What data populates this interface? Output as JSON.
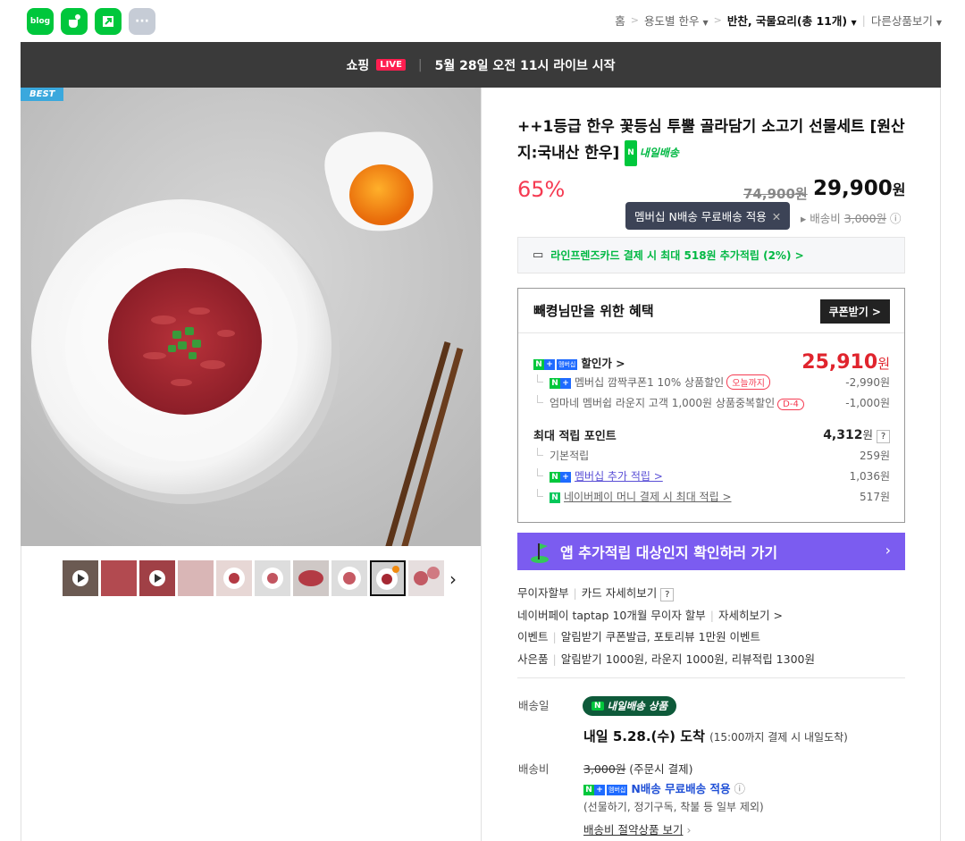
{
  "top_icons": [
    {
      "name": "blog",
      "label": "blog",
      "color": "#00c73c"
    },
    {
      "name": "cafe",
      "label": "",
      "color": "#00c73c"
    },
    {
      "name": "modoo",
      "label": "",
      "color": "#00c73c"
    },
    {
      "name": "more",
      "label": "···",
      "color": "#c6ccd6"
    }
  ],
  "breadcrumb": {
    "home": "홈",
    "level1": "용도별 한우",
    "level2": "반찬, 국물요리(총 ",
    "level2_count": "11",
    "level2_suffix": "개)",
    "other": "다른상품보기"
  },
  "live": {
    "label": "쇼핑",
    "badge": "LIVE",
    "text": "5월 28일 오전 11시 라이브 시작"
  },
  "product": {
    "best_badge": "BEST",
    "title": "++1등급 한우 꽃등심 투뿔 골라담기 소고기 선물세트 [원산지:국내산 한우]",
    "delivery_badge": "내일배송",
    "discount": "65%",
    "original_price": "74,900원",
    "sale_price": "29,900",
    "sale_unit": "원",
    "tooltip": "멤버십 N배송 무료배송 적용",
    "shipping_label": "배송비",
    "shipping_fee": "3,000원",
    "card_benefit": "라인프렌즈카드 결제 시 최대 518원 추가적립 (2%) >"
  },
  "benefit": {
    "title": "빼켱님만을 위한 혜택",
    "coupon_button": "쿠폰받기 >",
    "discount_label": "할인가 >",
    "discount_price": "25,910",
    "discount_unit": "원",
    "coupon1_text": "멤버십 깜짝쿠폰1 10% 상품할인",
    "coupon1_pill": "오늘까지",
    "coupon1_value": "-2,990원",
    "coupon2_text": "엄마네 멤버쉽 라운지 고객 1,000원 상품중복할인",
    "coupon2_pill": "D-4",
    "coupon2_value": "-1,000원",
    "points_label": "최대 적립 포인트",
    "points_value": "4,312",
    "points_unit": "원",
    "base_label": "기본적립",
    "base_value": "259원",
    "member_label": "멤버십 추가 적립 >",
    "member_value": "1,036원",
    "pay_label": "네이버페이 머니 결제 시 최대 적립 >",
    "pay_value": "517원"
  },
  "app_banner": "앱 추가적립 대상인지 확인하러 가기",
  "info": {
    "line1_a": "무이자할부",
    "line1_b": "카드 자세히보기",
    "line2_a": "네이버페이 taptap 10개월 무이자 할부",
    "line2_b": "자세히보기 >",
    "line3_a": "이벤트",
    "line3_b": "알림받기 쿠폰발급, 포토리뷰 1만원 이벤트",
    "line4_a": "사은품",
    "line4_b": "알림받기 1000원, 라운지 1000원, 리뷰적립 1300원"
  },
  "delivery": {
    "date_label": "배송일",
    "badge": "내일배송 상품",
    "arrive": "내일 5.28.(수) 도착",
    "arrive_note": "(15:00까지 결제 시 내일도착)",
    "fee_label": "배송비",
    "fee_original": "3,000원",
    "fee_note": "(주문시 결제)",
    "free_text": "N배송 무료배송 적용",
    "exclude": "(선물하기, 정기구독, 착불 등 일부 제외)",
    "save_link": "배송비 절약상품 보기"
  }
}
